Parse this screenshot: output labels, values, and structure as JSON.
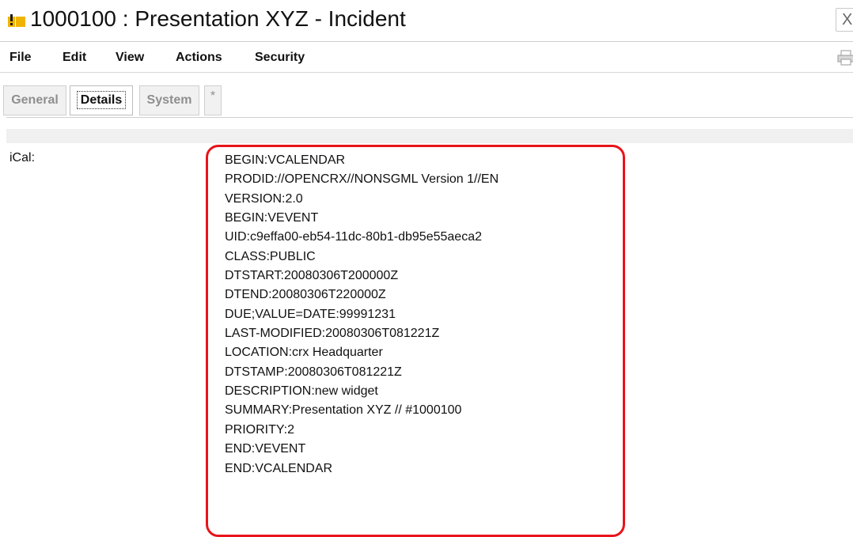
{
  "window": {
    "title": "1000100 : Presentation XYZ - Incident",
    "close_label": "X",
    "icon": "incident-alert-icon"
  },
  "menu": {
    "items": [
      {
        "label": "File"
      },
      {
        "label": "Edit"
      },
      {
        "label": "View"
      },
      {
        "label": "Actions"
      },
      {
        "label": "Security"
      }
    ],
    "print_icon": "print-icon"
  },
  "tabs": [
    {
      "label": "General",
      "active": false
    },
    {
      "label": "Details",
      "active": true
    },
    {
      "label": "System",
      "active": false
    },
    {
      "label": "*",
      "active": false
    }
  ],
  "details": {
    "field_label": "iCal:",
    "ical_lines": [
      "BEGIN:VCALENDAR",
      "PRODID://OPENCRX//NONSGML Version 1//EN",
      "VERSION:2.0",
      "BEGIN:VEVENT",
      "UID:c9effa00-eb54-11dc-80b1-db95e55aeca2",
      "CLASS:PUBLIC",
      "DTSTART:20080306T200000Z",
      "DTEND:20080306T220000Z",
      "DUE;VALUE=DATE:99991231",
      "LAST-MODIFIED:20080306T081221Z",
      "LOCATION:crx Headquarter",
      "DTSTAMP:20080306T081221Z",
      "DESCRIPTION:new widget",
      "SUMMARY:Presentation XYZ // #1000100",
      "PRIORITY:2",
      "END:VEVENT",
      "END:VCALENDAR"
    ]
  },
  "colors": {
    "highlight_border": "#e8141a",
    "icon_yellow": "#f0b400"
  }
}
